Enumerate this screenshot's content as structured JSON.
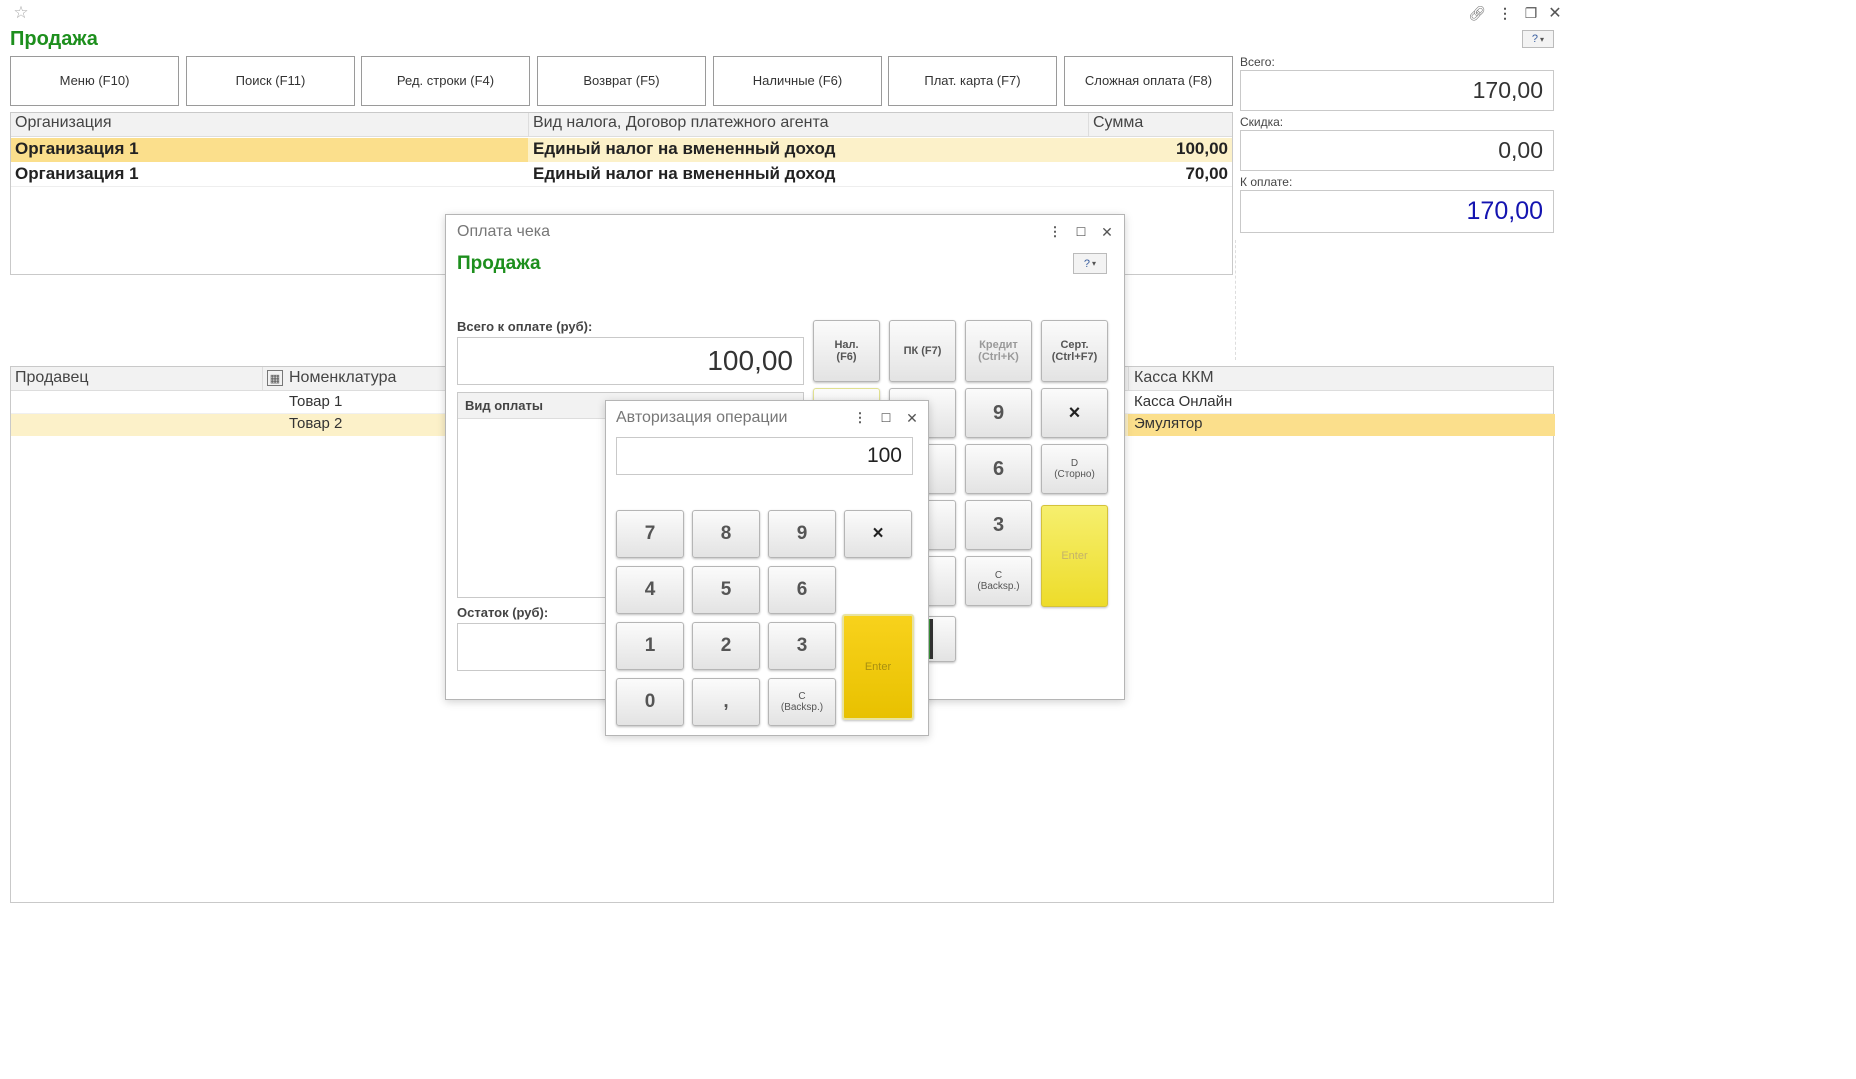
{
  "window": {
    "title": "Продажа"
  },
  "toolbar": {
    "buttons": [
      {
        "label": "Меню (F10)"
      },
      {
        "label": "Поиск (F11)"
      },
      {
        "label": "Ред. строки (F4)"
      },
      {
        "label": "Возврат (F5)"
      },
      {
        "label": "Наличные (F6)"
      },
      {
        "label": "Плат. карта (F7)"
      },
      {
        "label": "Сложная оплата (F8)"
      }
    ]
  },
  "totals": {
    "total_label": "Всего:",
    "total_value": "170,00",
    "discount_label": "Скидка:",
    "discount_value": "0,00",
    "topay_label": "К оплате:",
    "topay_value": "170,00",
    "topay_color": "#1414b0"
  },
  "org_table": {
    "headers": [
      "Организация",
      "Вид налога, Договор платежного агента",
      "Сумма"
    ],
    "rows": [
      {
        "org": "Организация 1",
        "tax": "Единый налог на вмененный доход",
        "sum": "100,00"
      },
      {
        "org": "Организация 1",
        "tax": "Единый налог на вмененный доход",
        "sum": "70,00"
      }
    ]
  },
  "goods_table": {
    "headers": [
      "Продавец",
      "Номенклатура",
      "Касса ККМ"
    ],
    "rows": [
      {
        "seller": "",
        "item": "Товар 1",
        "kkm": "Касса Онлайн"
      },
      {
        "seller": "",
        "item": "Товар 2",
        "kkm": "Эмулятор"
      }
    ]
  },
  "payment_dialog": {
    "title": "Оплата чека",
    "subtitle": "Продажа",
    "total_label": "Всего к оплате (руб):",
    "total_value": "100,00",
    "paytype_header": "Вид оплаты",
    "remainder_label": "Остаток (руб):",
    "keys": {
      "cash": "Нал.\n(F6)",
      "card": "ПК (F7)",
      "credit": "Кредит\n(Ctrl+K)",
      "cert": "Серт.\n(Ctrl+F7)",
      "k9": "9",
      "k6": "6",
      "k3": "3",
      "times": "×",
      "storno": "D\n(Сторно)",
      "back": "C\n(Backsp.)",
      "enter": "Enter"
    }
  },
  "auth_dialog": {
    "title": "Авторизация операции",
    "value": "100",
    "keys": {
      "k7": "7",
      "k8": "8",
      "k9": "9",
      "times": "×",
      "k4": "4",
      "k5": "5",
      "k6": "6",
      "k1": "1",
      "k2": "2",
      "k3": "3",
      "k0": "0",
      "comma": ",",
      "back": "C\n(Backsp.)",
      "enter": "Enter"
    }
  }
}
